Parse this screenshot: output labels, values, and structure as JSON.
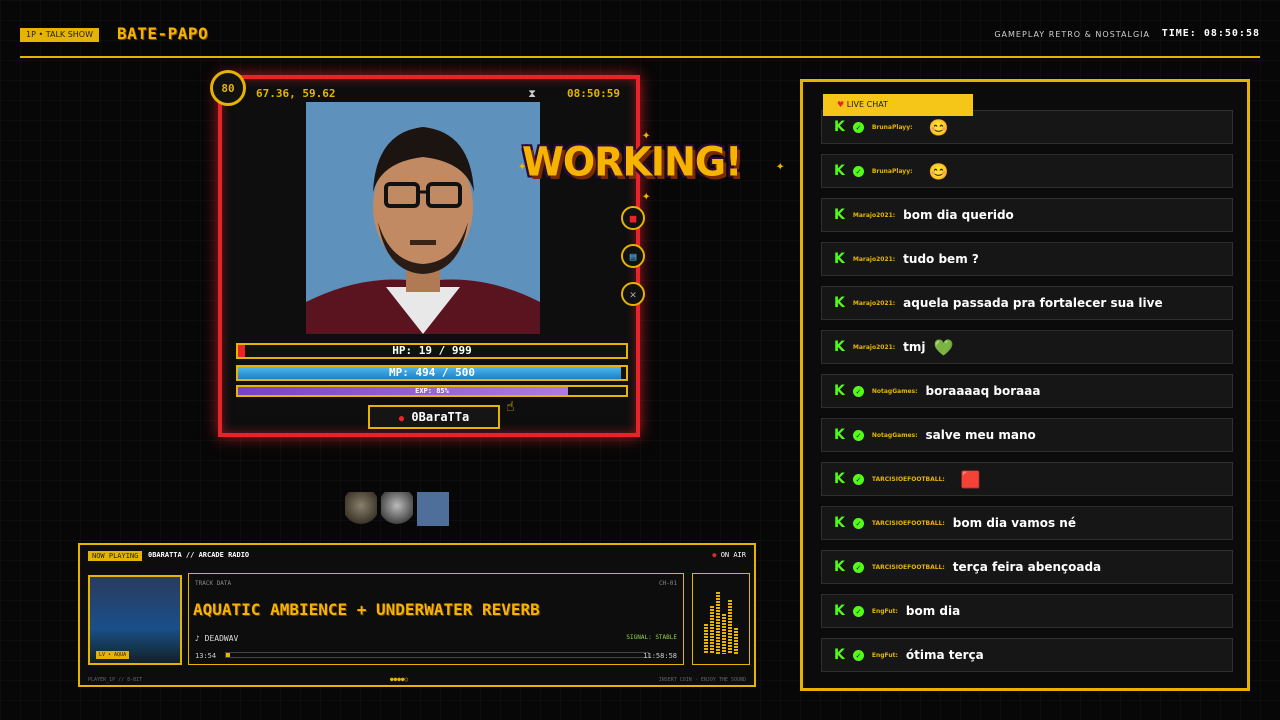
{
  "topbar": {
    "tag": "1P • TALK SHOW",
    "logo": "BATE-PAPO",
    "subtitle": "GAMEPLAY RETRO & NOSTALGIA",
    "clock": "TIME: 08:50:58"
  },
  "card": {
    "level": "80",
    "coords": "67.36, 59.62",
    "time": "08:50:59",
    "hp_label": "HP: 19 / 999",
    "hp_fraction": 0.019,
    "mp_label": "MP: 494 / 500",
    "mp_fraction": 0.988,
    "exp_label": "EXP: 85%",
    "exp_fraction": 0.85,
    "name": "0BaraTTa",
    "side_icons": [
      "lock-icon",
      "book-icon",
      "close-icon"
    ]
  },
  "working_badge": "WORKING!",
  "player": {
    "tag": "NOW PLAYING",
    "title": "0BARATTA // ARCADE RADIO",
    "on_air": "ON AIR",
    "track_label": "TRACK DATA",
    "channel": "CH-01",
    "track": "AQUATIC AMBIENCE + UNDERWATER REVERB",
    "artist": "♪ DEADWAV",
    "signal": "SIGNAL: STABLE",
    "time_start": "13:54",
    "time_end": "11:58:58",
    "progress": 0.01,
    "album_label": "LV • AQUA",
    "foot_left": "PLAYER_1P // 8-BIT",
    "foot_mid": "●●●●○",
    "foot_right": "INSERT COIN · ENJOY THE SOUND"
  },
  "chat": {
    "tab": "LIVE CHAT",
    "messages": [
      {
        "user": "BrunaPlayy:",
        "text": "",
        "emoji": "😊",
        "verified": true
      },
      {
        "user": "BrunaPlayy:",
        "text": "",
        "emoji": "😊",
        "verified": true
      },
      {
        "user": "Marajo2021:",
        "text": "bom dia querido",
        "emoji": "",
        "verified": false
      },
      {
        "user": "Marajo2021:",
        "text": "tudo bem ?",
        "emoji": "",
        "verified": false
      },
      {
        "user": "Marajo2021:",
        "text": "aquela passada pra fortalecer sua live",
        "emoji": "",
        "verified": false
      },
      {
        "user": "Marajo2021:",
        "text": "tmj",
        "emoji": "💚",
        "verified": false
      },
      {
        "user": "NotagGames:",
        "text": "boraaaaq boraaa",
        "emoji": "",
        "verified": true
      },
      {
        "user": "NotagGames:",
        "text": "salve meu mano",
        "emoji": "",
        "verified": true
      },
      {
        "user": "TARCISIOEFOOTBALL:",
        "text": "",
        "emoji": "🟥",
        "verified": true
      },
      {
        "user": "TARCISIOEFOOTBALL:",
        "text": "bom dia vamos né",
        "emoji": "",
        "verified": true
      },
      {
        "user": "TARCISIOEFOOTBALL:",
        "text": "terça feira abençoada",
        "emoji": "",
        "verified": true
      },
      {
        "user": "EngFut:",
        "text": "bom dia",
        "emoji": "",
        "verified": true
      },
      {
        "user": "EngFut:",
        "text": "ótima terça",
        "emoji": "",
        "verified": true
      }
    ]
  },
  "colors": {
    "accent": "#e6b400",
    "danger": "#e8232a",
    "kick_green": "#53fc18"
  }
}
